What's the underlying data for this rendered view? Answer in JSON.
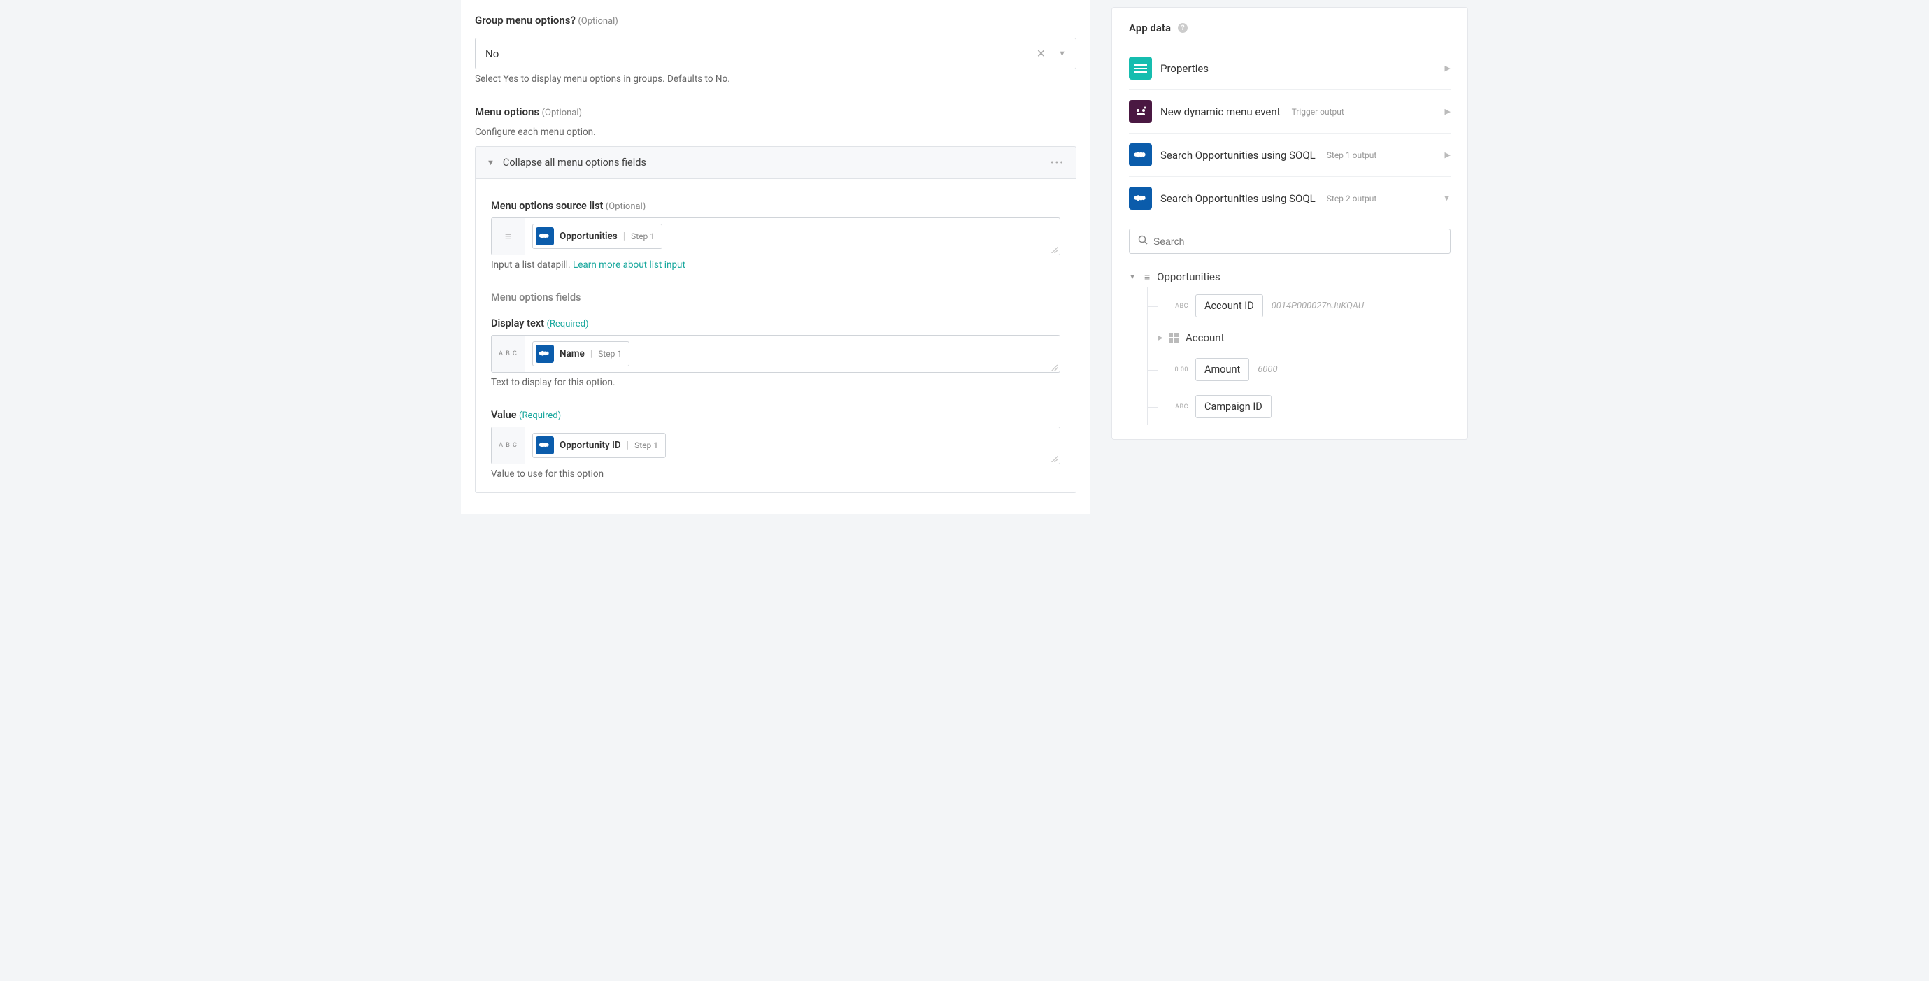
{
  "main": {
    "group_menu": {
      "label": "Group menu options?",
      "optional": "(Optional)",
      "value": "No",
      "help": "Select Yes to display menu options in groups. Defaults to No."
    },
    "menu_options": {
      "label": "Menu options",
      "optional": "(Optional)",
      "help": "Configure each menu option.",
      "collapse_label": "Collapse all menu options fields"
    },
    "source_list": {
      "label": "Menu options source list",
      "optional": "(Optional)",
      "pill_name": "Opportunities",
      "pill_step": "Step 1",
      "help_text": "Input a list datapill. ",
      "help_link": "Learn more about list input"
    },
    "fields_label": "Menu options fields",
    "display_text": {
      "label": "Display text",
      "required": "(Required)",
      "pill_name": "Name",
      "pill_step": "Step 1",
      "help": "Text to display for this option."
    },
    "value_field": {
      "label": "Value",
      "required": "(Required)",
      "pill_name": "Opportunity ID",
      "pill_step": "Step 1",
      "help": "Value to use for this option"
    }
  },
  "sidebar": {
    "title": "App data",
    "items": [
      {
        "label": "Properties",
        "sub": "",
        "icon": "teal"
      },
      {
        "label": "New dynamic menu event",
        "sub": "Trigger output",
        "icon": "purple"
      },
      {
        "label": "Search Opportunities using SOQL",
        "sub": "Step 1 output",
        "icon": "sf"
      },
      {
        "label": "Search Opportunities using SOQL",
        "sub": "Step 2 output",
        "icon": "sf"
      }
    ],
    "search_placeholder": "Search",
    "tree": {
      "title": "Opportunities",
      "fields": [
        {
          "type": "ABC",
          "name": "Account ID",
          "sample": "0014P000027nJuKQAU",
          "kind": "pill"
        },
        {
          "type": "",
          "name": "Account",
          "sample": "",
          "kind": "object"
        },
        {
          "type": "0.00",
          "name": "Amount",
          "sample": "6000",
          "kind": "pill"
        },
        {
          "type": "ABC",
          "name": "Campaign ID",
          "sample": "",
          "kind": "pill"
        }
      ]
    }
  }
}
